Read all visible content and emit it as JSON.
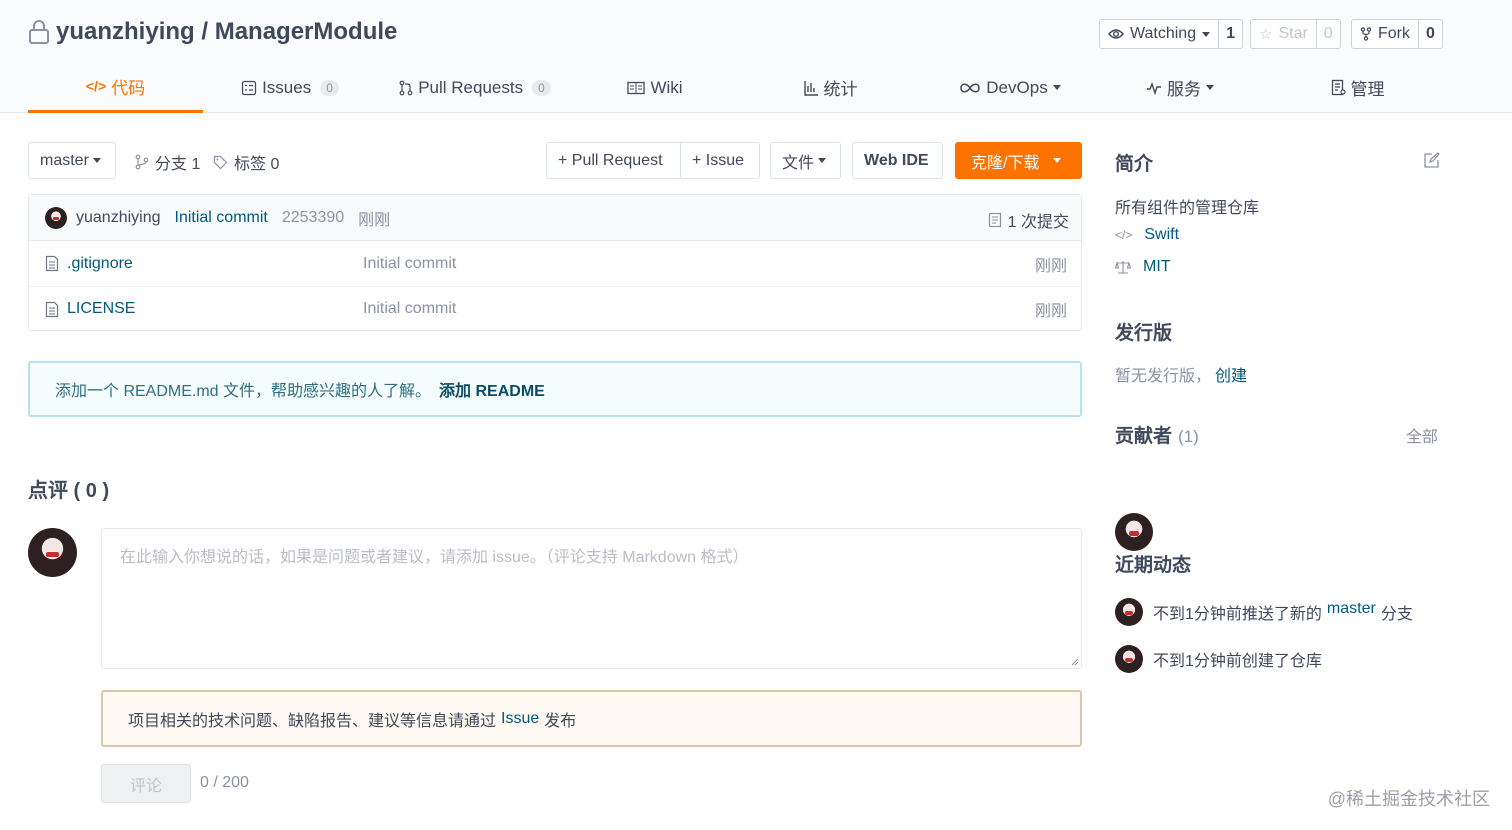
{
  "header": {
    "owner": "yuanzhiying",
    "separator": " / ",
    "repo": "ManagerModule",
    "watching": {
      "label": "Watching",
      "count": "1"
    },
    "star": {
      "label": "Star",
      "count": "0"
    },
    "fork": {
      "label": "Fork",
      "count": "0"
    }
  },
  "tabs": [
    {
      "label": "代码",
      "icon": "code-icon",
      "active": true
    },
    {
      "label": "Issues",
      "badge": "0",
      "icon": "issues-icon"
    },
    {
      "label": "Pull Requests",
      "badge": "0",
      "icon": "pull-request-icon"
    },
    {
      "label": "Wiki",
      "icon": "wiki-icon"
    },
    {
      "label": "统计",
      "icon": "stats-icon"
    },
    {
      "label": "DevOps",
      "icon": "infinity-icon"
    },
    {
      "label": "服务",
      "icon": "pulse-icon"
    },
    {
      "label": "管理",
      "icon": "manage-icon"
    }
  ],
  "branch_bar": {
    "branch": "master",
    "branches_label": "分支 1",
    "tags_label": "标签 0",
    "pull_request_btn": "+ Pull Request",
    "issue_btn": "+ Issue",
    "file_btn": "文件",
    "web_ide_btn": "Web IDE",
    "clone_btn": "克隆/下载"
  },
  "last_commit": {
    "author": "yuanzhiying",
    "message": "Initial commit",
    "hash": "2253390",
    "time": "刚刚",
    "commits_label": "1 次提交"
  },
  "files": [
    {
      "name": ".gitignore",
      "commit": "Initial commit",
      "time": "刚刚"
    },
    {
      "name": "LICENSE",
      "commit": "Initial commit",
      "time": "刚刚"
    }
  ],
  "readme_tip": {
    "text": "添加一个 README.md 文件，帮助感兴趣的人了解。",
    "link": "添加 README"
  },
  "comments": {
    "title": "点评 ( 0 )",
    "placeholder": "在此输入你想说的话，如果是问题或者建议，请添加 issue。（评论支持 Markdown 格式）",
    "tip_prefix": "项目相关的技术问题、缺陷报告、建议等信息请通过",
    "tip_link": "Issue",
    "tip_suffix": "发布",
    "submit": "评论",
    "counter": "0 / 200"
  },
  "sidebar": {
    "intro_title": "简介",
    "description": "所有组件的管理仓库",
    "language": "Swift",
    "license": "MIT",
    "releases_title": "发行版",
    "releases_empty": "暂无发行版，",
    "releases_create": "创建",
    "contributors_title": "贡献者",
    "contributors_count": "(1)",
    "contributors_all": "全部",
    "activity_title": "近期动态",
    "activity": [
      {
        "prefix": "不到1分钟前推送了新的",
        "link": "master",
        "suffix": "分支"
      },
      {
        "prefix": "不到1分钟前创建了仓库",
        "link": "",
        "suffix": ""
      }
    ]
  },
  "watermark": "@稀土掘金技术社区",
  "colors": {
    "accent": "#fe7300",
    "link": "#005980",
    "text": "#40485b"
  }
}
